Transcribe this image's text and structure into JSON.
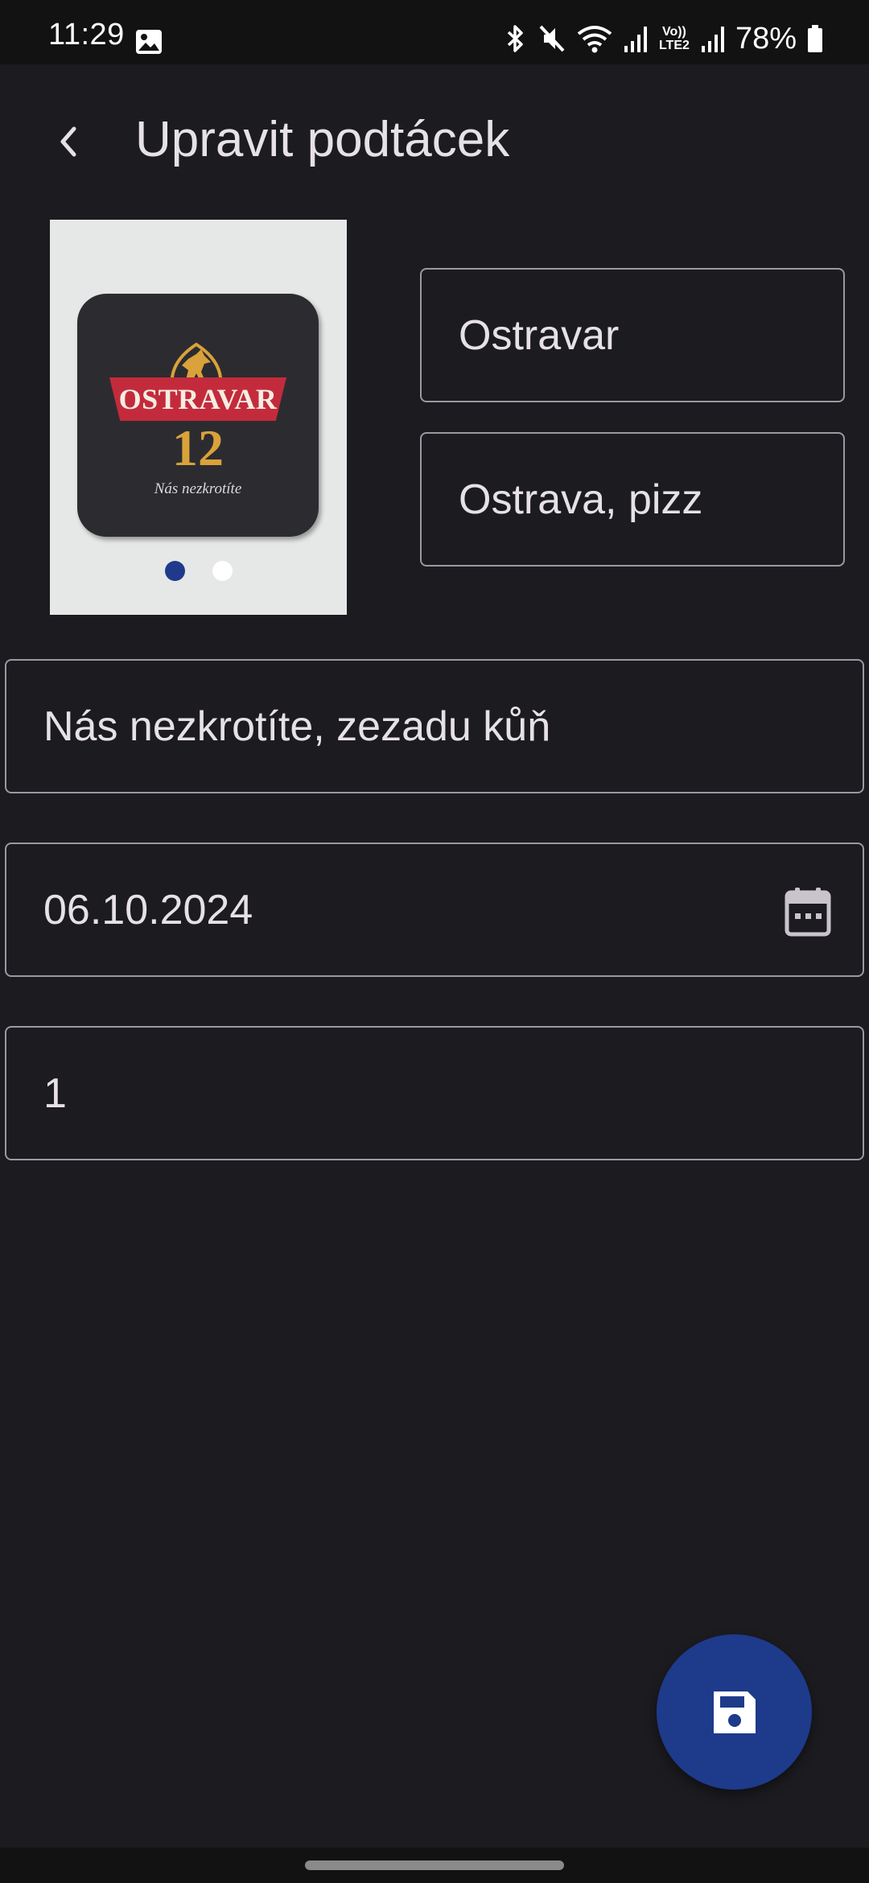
{
  "status_bar": {
    "time": "11:29",
    "battery": "78%",
    "network_label": "Vo)) LTE2",
    "icons": [
      "gallery-icon",
      "bluetooth-icon",
      "mute-icon",
      "wifi-icon",
      "signal-icon",
      "signal-icon",
      "battery-icon"
    ]
  },
  "header": {
    "title": "Upravit podtácek",
    "back_icon": "chevron-left-icon"
  },
  "photo": {
    "coaster_brand": "OSTRAVAR",
    "coaster_number": "12",
    "coaster_slogan": "Nás nezkrotíte",
    "pager_total": 2,
    "pager_active": 1
  },
  "form": {
    "name": "Ostravar",
    "place": "Ostrava, pizz",
    "note": "Nás nezkrotíte, zezadu kůň",
    "date": "06.10.2024",
    "count": "1",
    "date_icon": "calendar-icon"
  },
  "fab": {
    "icon": "save-icon"
  },
  "colors": {
    "background": "#1c1b20",
    "outline": "#9c98a0",
    "fab": "#1e3a8a",
    "pager_active": "#1f3a8a",
    "pager_inactive": "#ffffff",
    "coaster_red": "#c32b3c",
    "coaster_gold": "#d9a23a"
  }
}
